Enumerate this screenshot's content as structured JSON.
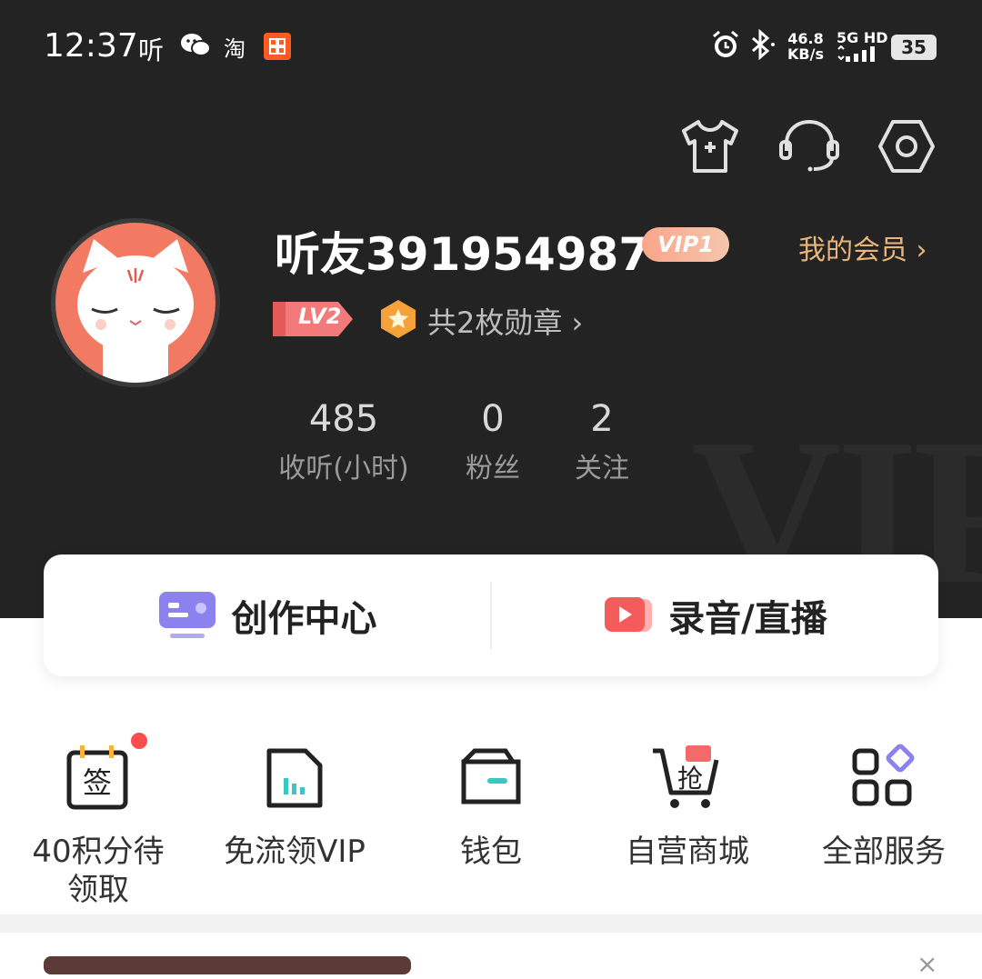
{
  "status_bar": {
    "time": "12:37",
    "app1": "听",
    "app3": "淘",
    "net_speed_top": "46.8",
    "net_speed_bottom": "KB/s",
    "network": "5G HD",
    "battery": "35"
  },
  "profile": {
    "username": "听友391954987",
    "vip_badge": "VIP1",
    "my_member": "我的会员 ›",
    "level": "LV2",
    "medals": "共2枚勋章 ›"
  },
  "stats": [
    {
      "value": "485",
      "label": "收听(小时)"
    },
    {
      "value": "0",
      "label": "粉丝"
    },
    {
      "value": "2",
      "label": "关注"
    }
  ],
  "header_watermark": "VIP",
  "actions": {
    "create_center": "创作中心",
    "record_live": "录音/直播"
  },
  "services": [
    {
      "label": "40积分待领取",
      "icon": "checkin-icon"
    },
    {
      "label": "免流领VIP",
      "icon": "sim-card-icon"
    },
    {
      "label": "钱包",
      "icon": "wallet-icon"
    },
    {
      "label": "自营商城",
      "icon": "shopping-cart-icon"
    },
    {
      "label": "全部服务",
      "icon": "all-services-icon"
    }
  ],
  "checkin_glyph": "签",
  "cart_glyph": "抢",
  "colors": {
    "header_bg": "#232323",
    "accent_gold": "#e8b67c",
    "vip_badge": "#f9a58a",
    "avatar_bg": "#f27a62",
    "service_accent": "#38c7c2",
    "badge_red": "#ff4d4d"
  }
}
